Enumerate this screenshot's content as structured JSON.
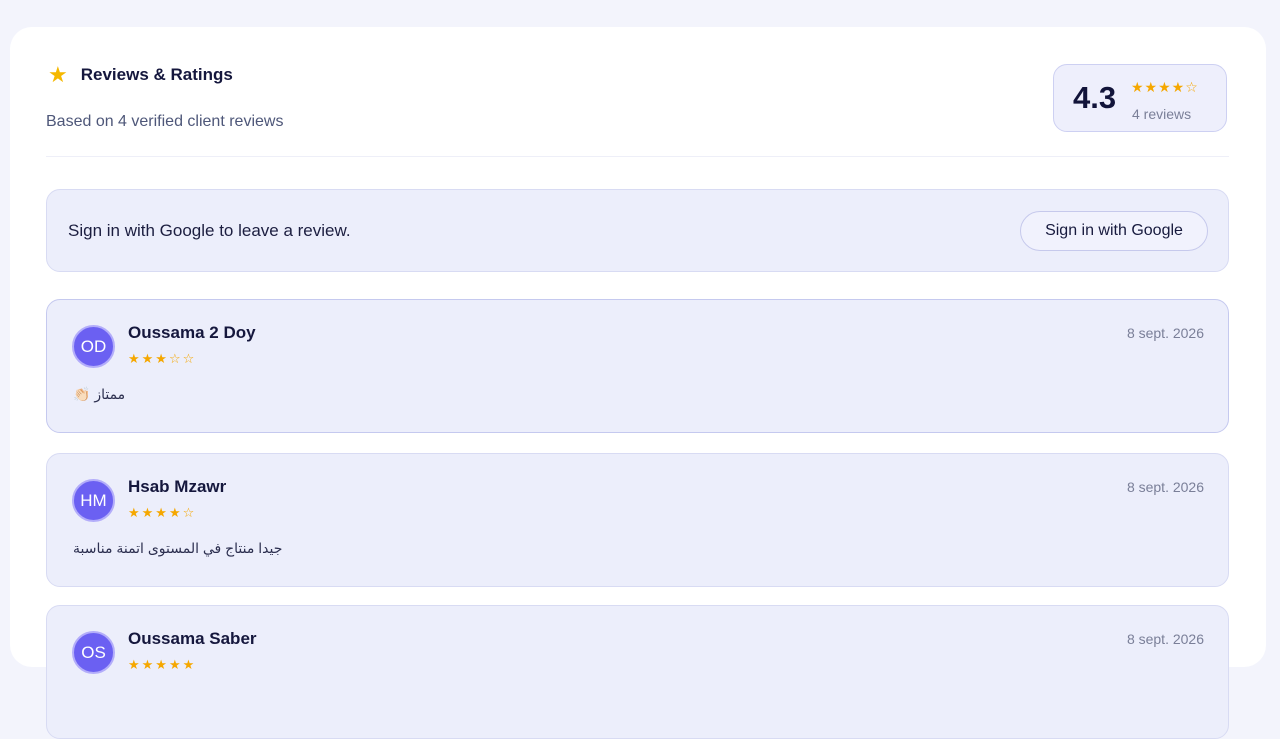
{
  "header": {
    "icon": "star-icon",
    "title": "Reviews & Ratings",
    "subtitle": "Based on 4 verified client reviews"
  },
  "summary": {
    "average": "4.3",
    "stars": "★★★★☆",
    "rating": 4.3,
    "count_label": "4 reviews"
  },
  "signin": {
    "message": "Sign in with Google to leave a review.",
    "button_label": "Sign in with Google"
  },
  "colors": {
    "accent": "#6b60f2",
    "star": "#f5a700",
    "card_bg": "#eceefb"
  },
  "reviews": [
    {
      "initials": "OD",
      "name": "Oussama 2 Doy",
      "stars": "★★★☆☆",
      "rating": 3,
      "date": "8 sept. 2026",
      "text": "ممتاز 👏🏻"
    },
    {
      "initials": "HM",
      "name": "Hsab Mzawr",
      "stars": "★★★★☆",
      "rating": 4,
      "date": "8 sept. 2026",
      "text": "جيدا منتاج في المستوى اتمنة مناسبة"
    },
    {
      "initials": "OS",
      "name": "Oussama Saber",
      "stars": "★★★★★",
      "rating": 5,
      "date": "8 sept. 2026",
      "text": ""
    }
  ]
}
